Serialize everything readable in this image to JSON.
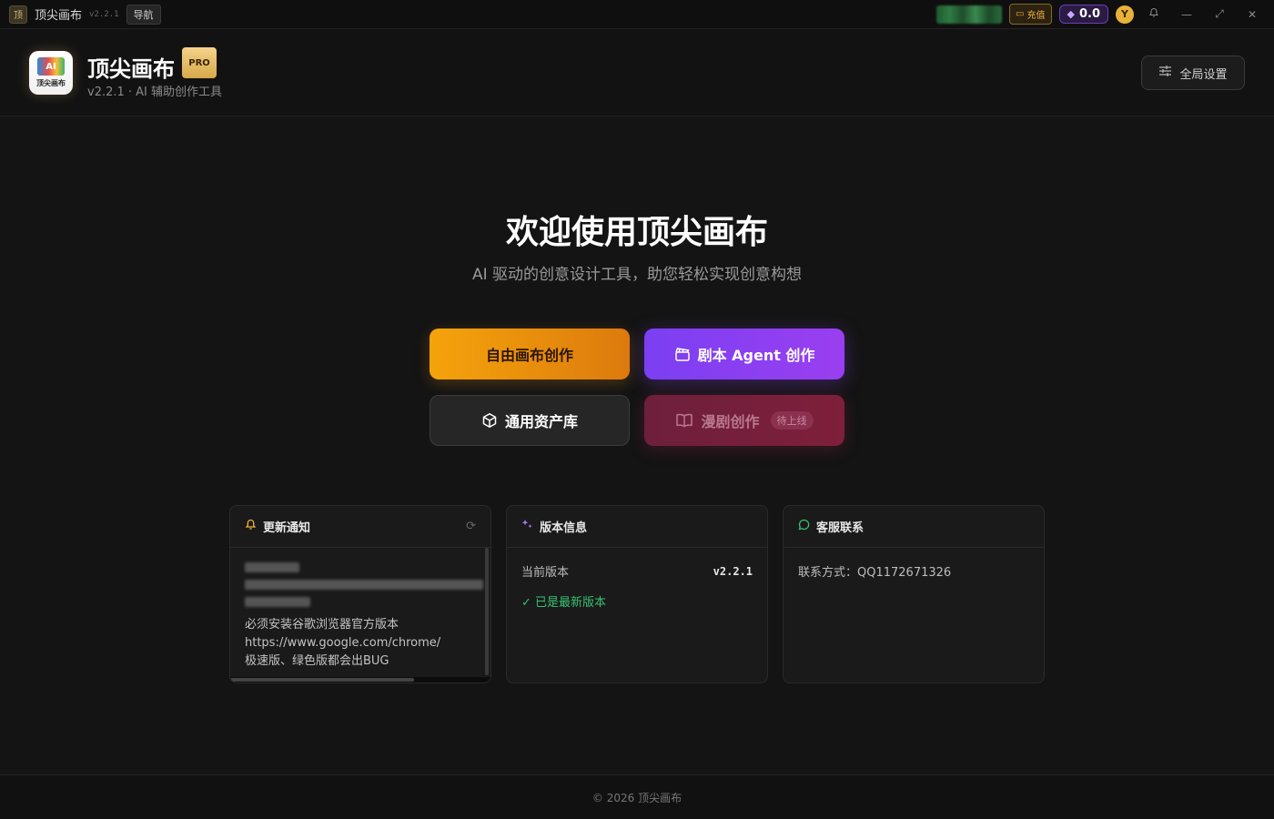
{
  "titlebar": {
    "logo_glyph": "顶",
    "title": "顶尖画布",
    "version": "v2.2.1",
    "nav_label": "导航",
    "recharge_label": "充值",
    "balance": "0.0",
    "avatar_initial": "Y"
  },
  "header": {
    "logo_badge": "AI",
    "logo_text": "顶尖画布",
    "app_name": "顶尖画布",
    "pro_label": "PRO",
    "subtitle": "v2.2.1 · AI 辅助创作工具",
    "settings_label": "全局设置"
  },
  "hero": {
    "title": "欢迎使用顶尖画布",
    "subtitle": "AI 驱动的创意设计工具，助您轻松实现创意构想"
  },
  "actions": {
    "free_canvas": "自由画布创作",
    "agent": "剧本 Agent 创作",
    "assets": "通用资产库",
    "comic": "漫剧创作",
    "comic_badge": "待上线"
  },
  "cards": {
    "notice": {
      "title": "更新通知",
      "lines": [
        "必须安装谷歌浏览器官方版本",
        "https://www.google.com/chrome/",
        "极速版、绿色版都会出BUG"
      ]
    },
    "version": {
      "title": "版本信息",
      "current_label": "当前版本",
      "current_value": "v2.2.1",
      "status": "✓ 已是最新版本"
    },
    "support": {
      "title": "客服联系",
      "contact": "联系方式：QQ1172671326"
    }
  },
  "footer": {
    "copyright": "© 2026 顶尖画布"
  },
  "colors": {
    "orange": "#f5a30c",
    "purple": "#7b3ff2",
    "crimson": "#7e1f3b",
    "green": "#38c172",
    "gold": "#d7a94a"
  }
}
